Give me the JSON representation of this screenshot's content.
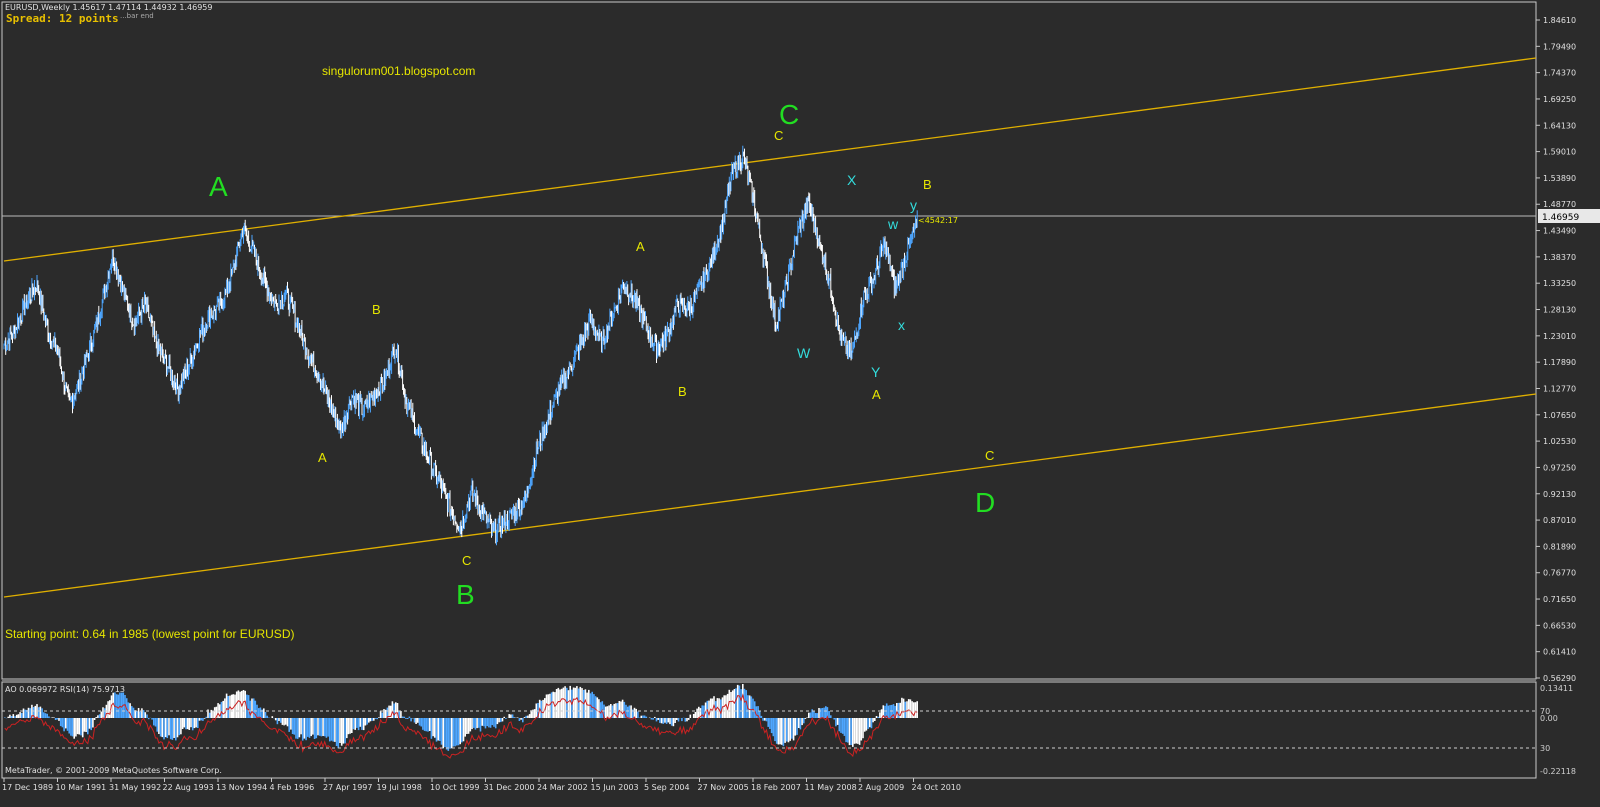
{
  "header": {
    "symbol_line": "EURUSD,Weekly  1.45617 1.47114 1.44932 1.46959",
    "spread": "Spread: 12 points",
    "subtitle": "...bar end"
  },
  "watermark": "singulorum001.blogspot.com",
  "note": "Starting point:  0.64 in 1985 (lowest point for EURUSD)",
  "price_marker": "<4542:17",
  "indicator": {
    "label": "AO 0.069972  RSI(14) 75.9713",
    "levels": [
      "70",
      "0.00",
      "30"
    ],
    "ticks": [
      "0.13411",
      "-0.22118"
    ]
  },
  "footer": "MetaTrader, © 2001-2009 MetaQuotes Software Corp.",
  "colors": {
    "background": "#2b2b2b",
    "bull_candle": "#4da6ff",
    "bear_candle": "#ffffff",
    "channel": "#e0b000",
    "primary_labels": "#22dd22",
    "secondary_labels": "#e6e600",
    "cyan_labels": "#33dddd",
    "rsi_line": "#cc2222"
  },
  "chart_data": {
    "type": "line",
    "title": "EURUSD,Weekly",
    "x_labels": [
      "17 Dec 1989",
      "10 Mar 1991",
      "31 May 1992",
      "22 Aug 1993",
      "13 Nov 1994",
      "4 Feb 1996",
      "27 Apr 1997",
      "19 Jul 1998",
      "10 Oct 1999",
      "31 Dec 2000",
      "24 Mar 2002",
      "15 Jun 2003",
      "5 Sep 2004",
      "27 Nov 2005",
      "18 Feb 2007",
      "11 May 2008",
      "2 Aug 2009",
      "24 Oct 2010"
    ],
    "y_ticks": [
      "1.84610",
      "1.79490",
      "1.74370",
      "1.69250",
      "1.64130",
      "1.59010",
      "1.53890",
      "1.48770",
      "1.43490",
      "1.38370",
      "1.33250",
      "1.28130",
      "1.23010",
      "1.17890",
      "1.12770",
      "1.07650",
      "1.02530",
      "0.97250",
      "0.92130",
      "0.87010",
      "0.81890",
      "0.76770",
      "0.71650",
      "0.66530",
      "0.61410",
      "0.56290"
    ],
    "current_price": "1.46959",
    "ylim": [
      0.5629,
      1.8461
    ],
    "series": [
      {
        "values": [
          1.22,
          1.25,
          1.3,
          1.34,
          1.25,
          1.2,
          1.1,
          1.15,
          1.22,
          1.3,
          1.4,
          1.32,
          1.26,
          1.3,
          1.22,
          1.18,
          1.13,
          1.18,
          1.24,
          1.28,
          1.3,
          1.36,
          1.45,
          1.4,
          1.34,
          1.3,
          1.32,
          1.26,
          1.2,
          1.16,
          1.1,
          1.05,
          1.12,
          1.09,
          1.12,
          1.15,
          1.22,
          1.11,
          1.05,
          1.0,
          0.95,
          0.9,
          0.86,
          0.93,
          0.89,
          0.85,
          0.87,
          0.89,
          0.92,
          1.01,
          1.07,
          1.13,
          1.17,
          1.22,
          1.27,
          1.22,
          1.28,
          1.34,
          1.31,
          1.26,
          1.21,
          1.24,
          1.3,
          1.29,
          1.33,
          1.38,
          1.45,
          1.56,
          1.59,
          1.5,
          1.38,
          1.26,
          1.34,
          1.44,
          1.5,
          1.42,
          1.34,
          1.23,
          1.2,
          1.31,
          1.35,
          1.42,
          1.33,
          1.4,
          1.46
        ]
      }
    ],
    "channel": {
      "upper": {
        "x": [
          "1989-09",
          "2012-11"
        ],
        "y": [
          1.377,
          1.775
        ]
      },
      "lower": {
        "x": [
          "1989-09",
          "2012-11"
        ],
        "y": [
          0.725,
          1.122
        ]
      }
    },
    "wave_labels": {
      "primary": [
        "A",
        "B",
        "C",
        "D"
      ],
      "secondary": [
        "A",
        "B",
        "C",
        "A",
        "B",
        "C",
        "A",
        "B",
        "C"
      ],
      "cyan": [
        "W",
        "X",
        "Y",
        "w",
        "x",
        "y"
      ]
    }
  }
}
